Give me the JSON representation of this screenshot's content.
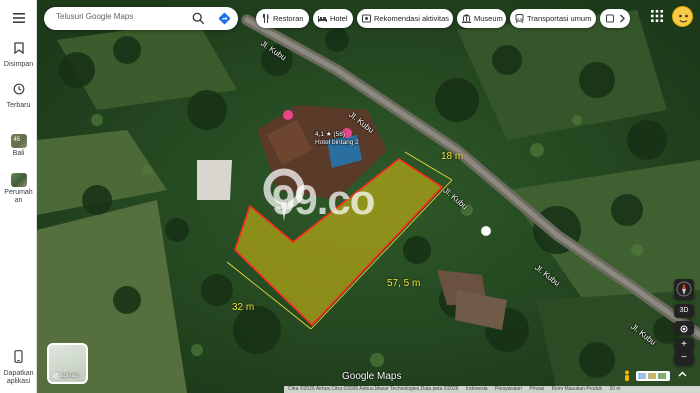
{
  "rail": {
    "menu_icon": "hamburger-menu-icon",
    "items": [
      {
        "label": "Disimpan",
        "icon": "bookmark-icon"
      },
      {
        "label": "Terbaru",
        "icon": "history-icon"
      },
      {
        "label": "Bali",
        "icon": "place-thumbnail"
      },
      {
        "label": "Perumahan",
        "icon": "place-thumbnail"
      },
      {
        "label": "Dapatkan aplikasi",
        "icon": "phone-icon"
      }
    ],
    "bali_thumb_text": "45"
  },
  "search": {
    "placeholder": "Telusuri Google Maps",
    "search_icon": "search-icon",
    "directions_icon": "directions-icon"
  },
  "chips": [
    {
      "label": "Restoran",
      "icon": "restaurant-icon"
    },
    {
      "label": "Hotel",
      "icon": "hotel-icon"
    },
    {
      "label": "Rekomendasi aktivitas",
      "icon": "activity-icon"
    },
    {
      "label": "Museum",
      "icon": "museum-icon"
    },
    {
      "label": "Transportasi umum",
      "icon": "transit-icon"
    }
  ],
  "chips_more_icon": "chevron-right-icon",
  "header": {
    "apps_icon": "apps-grid-icon",
    "avatar_icon": "avatar-icon"
  },
  "map": {
    "roads": [
      "Jl. Kubu",
      "Jl. Kubu",
      "Jl. Kubu",
      "Jl. Kubu",
      "Jl. Kubu"
    ],
    "hotel_rating": "4,1",
    "hotel_reviews": "(56)",
    "hotel_name": "Hotel bintang 2",
    "watermark": "99.co",
    "measurements": {
      "top": "18 m",
      "right": "57, 5 m",
      "left": "32 m"
    },
    "colors": {
      "plot_fill": "#c9b514",
      "plot_border": "#ff2a1f",
      "measure_line": "#f2e23b"
    }
  },
  "layers": {
    "label": "Lapisan",
    "icon": "layers-icon"
  },
  "controls": {
    "compass_icon": "compass-icon",
    "tilt": "3D",
    "locate_icon": "my-location-icon",
    "zoom_in": "+",
    "zoom_out": "−",
    "pegman_icon": "pegman-icon",
    "expand_icon": "expand-icon"
  },
  "footer": {
    "logo": "Google Maps",
    "attribution": "Citra ©2026 Airbus,Citra ©2026 Airbus,Maxar Technologies,Data peta ©2026",
    "links": [
      "Indonesia",
      "Persyaratan",
      "Privasi",
      "Kirim Masukan Produk"
    ],
    "scale": "20 m"
  }
}
